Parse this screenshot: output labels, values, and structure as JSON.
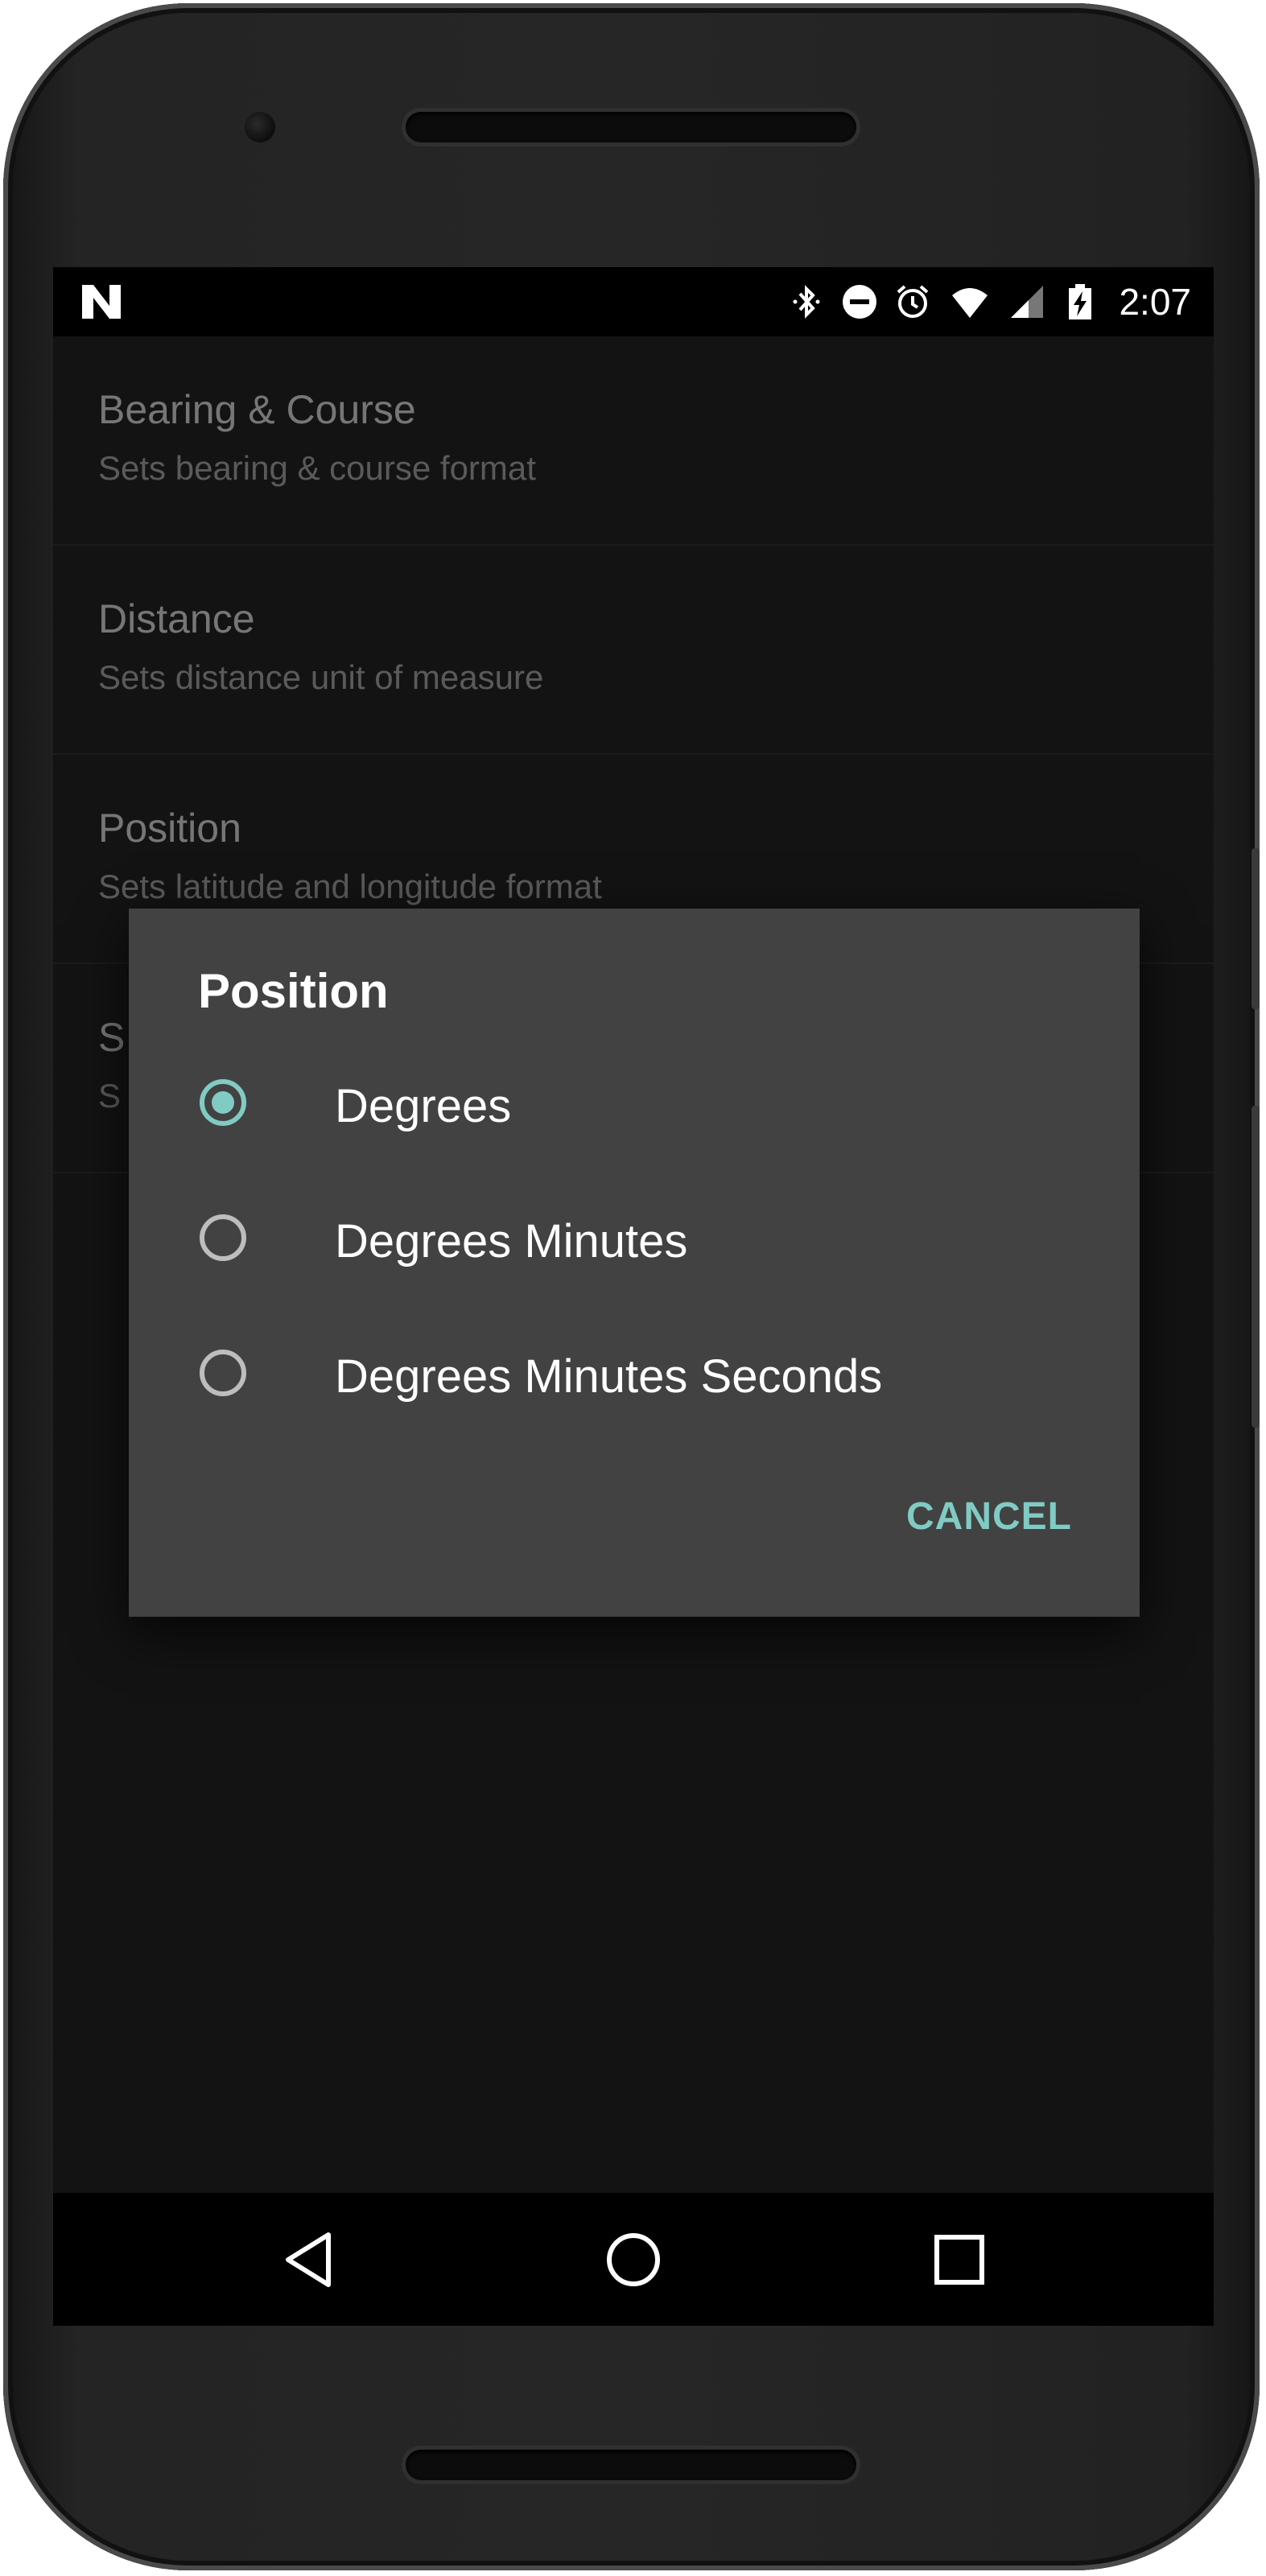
{
  "status_bar": {
    "time": "2:07",
    "icons": [
      "n-notification-icon",
      "bluetooth-icon",
      "do-not-disturb-icon",
      "alarm-icon",
      "wifi-icon",
      "signal-icon",
      "battery-charging-icon"
    ]
  },
  "preferences": [
    {
      "title": "Bearing & Course",
      "summary": "Sets bearing & course format"
    },
    {
      "title": "Distance",
      "summary": "Sets distance unit of measure"
    },
    {
      "title": "Position",
      "summary": "Sets latitude and longitude format"
    },
    {
      "title": "S",
      "summary": "S"
    }
  ],
  "dialog": {
    "title": "Position",
    "options": [
      {
        "label": "Degrees",
        "checked": true
      },
      {
        "label": "Degrees Minutes",
        "checked": false
      },
      {
        "label": "Degrees Minutes Seconds",
        "checked": false
      }
    ],
    "cancel_label": "CANCEL"
  },
  "navigation": {
    "buttons": [
      "back-icon",
      "home-icon",
      "recents-icon"
    ]
  },
  "colors": {
    "accent": "#80cbc4",
    "dialog_background": "#424242",
    "screen_background": "#131313"
  }
}
